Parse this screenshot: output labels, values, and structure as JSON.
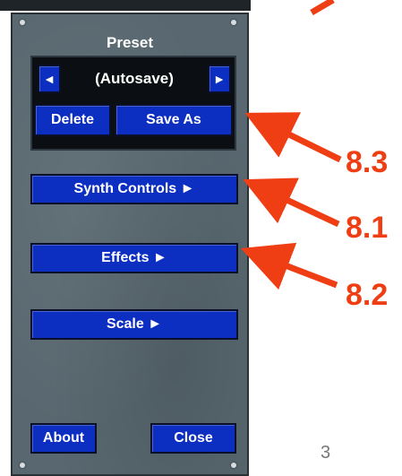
{
  "panel": {
    "title": "Preset",
    "preset": {
      "prev_icon": "◄",
      "name": "(Autosave)",
      "next_icon": "►",
      "delete_label": "Delete",
      "save_as_label": "Save As"
    },
    "buttons": {
      "synth_controls": "Synth Controls ►",
      "effects": "Effects ►",
      "scale": "Scale ►",
      "about": "About",
      "close": "Close"
    }
  },
  "annotations": {
    "label_a": "8.3",
    "label_b": "8.1",
    "label_c": "8.2",
    "color": "#ef3e14"
  },
  "slide_number": "3"
}
